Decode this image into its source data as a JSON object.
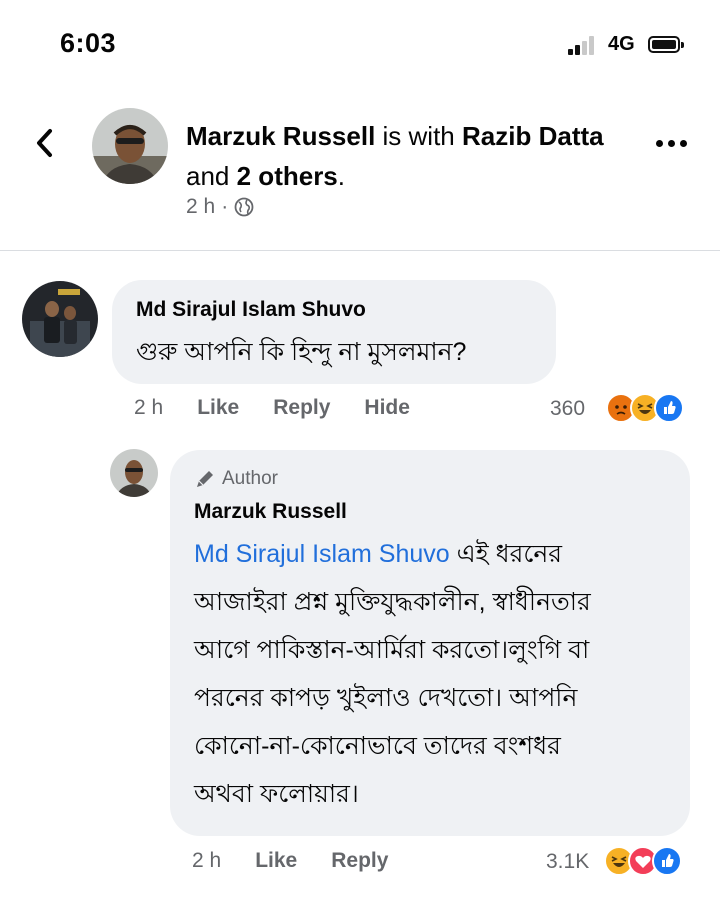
{
  "status_bar": {
    "time": "6:03",
    "network": "4G"
  },
  "post": {
    "author": "Marzuk Russell",
    "with_text": "is with",
    "tagged_person": "Razib Datta",
    "and_text": "and",
    "others_text": "2 others",
    "period": ".",
    "time": "2 h",
    "separator": "·",
    "privacy_icon": "globe-icon"
  },
  "comment": {
    "author": "Md Sirajul Islam Shuvo",
    "text": "গুরু আপনি কি হিন্দু না মুসলমান?",
    "time": "2 h",
    "actions": {
      "like": "Like",
      "reply": "Reply",
      "hide": "Hide"
    },
    "reaction_count": "360",
    "reactions": [
      "angry",
      "haha",
      "like"
    ]
  },
  "reply": {
    "badge": "Author",
    "author": "Marzuk Russell",
    "mention": "Md Sirajul Islam Shuvo",
    "text_line1_rest": " এই ধরনের",
    "text_line2": "আজাইরা প্রশ্ন মুক্তিযুদ্ধকালীন, স্বাধীনতার",
    "text_line3": "আগে পাকিস্তান-আর্মিরা করতো।লুংগি বা",
    "text_line4": "পরনের কাপড় খুইলাও দেখতো। আপনি",
    "text_line5": "কোনো-না-কোনোভাবে তাদের বংশধর",
    "text_line6": "অথবা ফলোয়ার।",
    "time": "2 h",
    "actions": {
      "like": "Like",
      "reply": "Reply"
    },
    "reaction_count": "3.1K",
    "reactions": [
      "haha",
      "love",
      "like"
    ]
  },
  "colors": {
    "mention": "#216fdb",
    "bubble": "#eff1f4",
    "meta": "#65676b",
    "like_blue": "#1877f2",
    "love_red": "#f33e58",
    "haha_yellow": "#f7b125",
    "angry_orange": "#e9710f"
  }
}
